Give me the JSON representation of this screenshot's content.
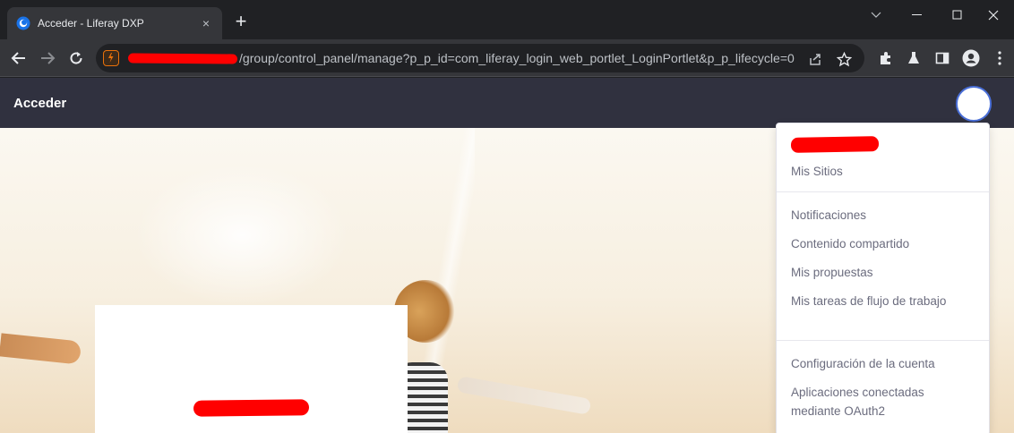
{
  "browser": {
    "tab_title": "Acceder - Liferay DXP",
    "tab_close": "×",
    "new_tab": "+",
    "url_visible": "/group/control_panel/manage?p_p_id=com_liferay_login_web_portlet_LoginPortlet&p_p_lifecycle=0"
  },
  "app": {
    "title": "Acceder"
  },
  "user_menu": {
    "my_sites": "Mis Sitios",
    "notifications": "Notificaciones",
    "shared_content": "Contenido compartido",
    "my_proposals": "Mis propuestas",
    "my_workflow_tasks": "Mis tareas de flujo de trabajo",
    "account_settings": "Configuración de la cuenta",
    "oauth_apps": "Aplicaciones conectadas mediante OAuth2"
  },
  "colors": {
    "app_header": "#30313f",
    "menu_text": "#6b6c7e",
    "redaction": "#ff0000"
  }
}
